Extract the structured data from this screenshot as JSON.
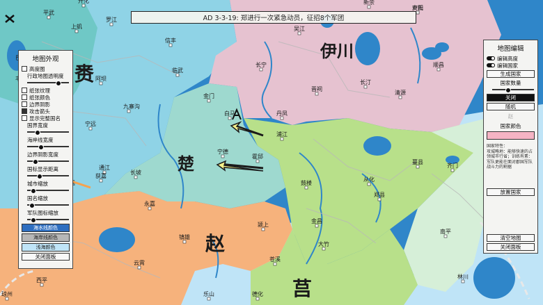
{
  "event_text": "AD 3-3-19: 郑进行一次紧急动员，征招8个军团",
  "nations": [
    {
      "name": "伊川"
    },
    {
      "name": "楚"
    },
    {
      "name": "赵"
    },
    {
      "name": "莒"
    },
    {
      "name": "赉"
    }
  ],
  "cities": [
    "平武",
    "开化",
    "上虮",
    "罗江",
    "信丰",
    "临武",
    "阿坝",
    "丰宁",
    "九寨沟",
    "宁远",
    "通江",
    "长坡",
    "金门",
    "白马",
    "丹凤",
    "宁德",
    "霍邱",
    "长宁",
    "晋祠",
    "长汀",
    "清源",
    "顺昌",
    "新余",
    "卢氏",
    "鼓楼",
    "从化",
    "郑县",
    "金昌",
    "大竹",
    "苍溪",
    "琼州",
    "颍上",
    "镇雄",
    "永嘉",
    "云霄",
    "大通",
    "吴江",
    "南平",
    "林川",
    "齐门",
    "蔓县",
    "浦江",
    "安阳",
    "巴县",
    "获嘉",
    "德化",
    "乐山",
    "西平"
  ],
  "left_panel": {
    "title": "地图外观",
    "items": [
      {
        "type": "check",
        "label": "高度图",
        "on": false
      },
      {
        "type": "label",
        "label": "行政地图透明度"
      },
      {
        "type": "slider",
        "value": 0.75
      },
      {
        "type": "check",
        "label": "纸张纹理",
        "on": false
      },
      {
        "type": "check",
        "label": "纸张颜色",
        "on": false
      },
      {
        "type": "check",
        "label": "边界阴影",
        "on": false
      },
      {
        "type": "check",
        "label": "攻击箭头",
        "on": true
      },
      {
        "type": "check",
        "label": "显示完整国名",
        "on": false
      },
      {
        "type": "label",
        "label": "国界宽度"
      },
      {
        "type": "slider",
        "value": 0.2
      },
      {
        "type": "label",
        "label": "海岸线宽度"
      },
      {
        "type": "slider",
        "value": 0.3
      },
      {
        "type": "label",
        "label": "边界阴影宽度"
      },
      {
        "type": "slider",
        "value": 0.15
      },
      {
        "type": "label",
        "label": "国标显示距离"
      },
      {
        "type": "slider",
        "value": 0.25
      },
      {
        "type": "label",
        "label": "城市缩放"
      },
      {
        "type": "slider",
        "value": 0.1
      },
      {
        "type": "label",
        "label": "国名缩放"
      },
      {
        "type": "slider",
        "value": 0.05
      },
      {
        "type": "label",
        "label": "军队图标缩放"
      },
      {
        "type": "slider",
        "value": 0.1
      }
    ],
    "color_swatches": [
      {
        "label": "海水线颜色",
        "color": "#2d6ec0"
      },
      {
        "label": "海岸线颜色",
        "color": "#b7b7b7"
      },
      {
        "label": "浅海颜色",
        "color": "#bfe4f7"
      }
    ],
    "close_label": "关闭面板"
  },
  "right_panel": {
    "title": "地图编辑",
    "toggles": [
      {
        "label": "编辑高度"
      },
      {
        "label": "编辑国家"
      }
    ],
    "generate_label": "生成国家",
    "count_label": "国家数量",
    "count_slider": 0.35,
    "close_btn_dark": "关闭",
    "random_label": "随机",
    "selected_nation": "赵",
    "nation_color_label": "国家颜色",
    "nation_color": "#f5b4c4",
    "traits_label": "国家特性：",
    "traits_text": "攻城略地：能够快速的占领城市行省；训练有素：军队更能在面对郡国军队战斗力的割据",
    "place_label": "放置国家",
    "clear_label": "清空地图",
    "close_label": "关闭面板"
  },
  "colors": {
    "sea": "#2f86c9",
    "shallow": "#bfe4f7",
    "pink": "#e6c2d0",
    "cyan": "#8fd3e6",
    "teal": "#9ed9cf",
    "green": "#b8e08a",
    "orange": "#f6b27c",
    "mint": "#d6efd8"
  }
}
